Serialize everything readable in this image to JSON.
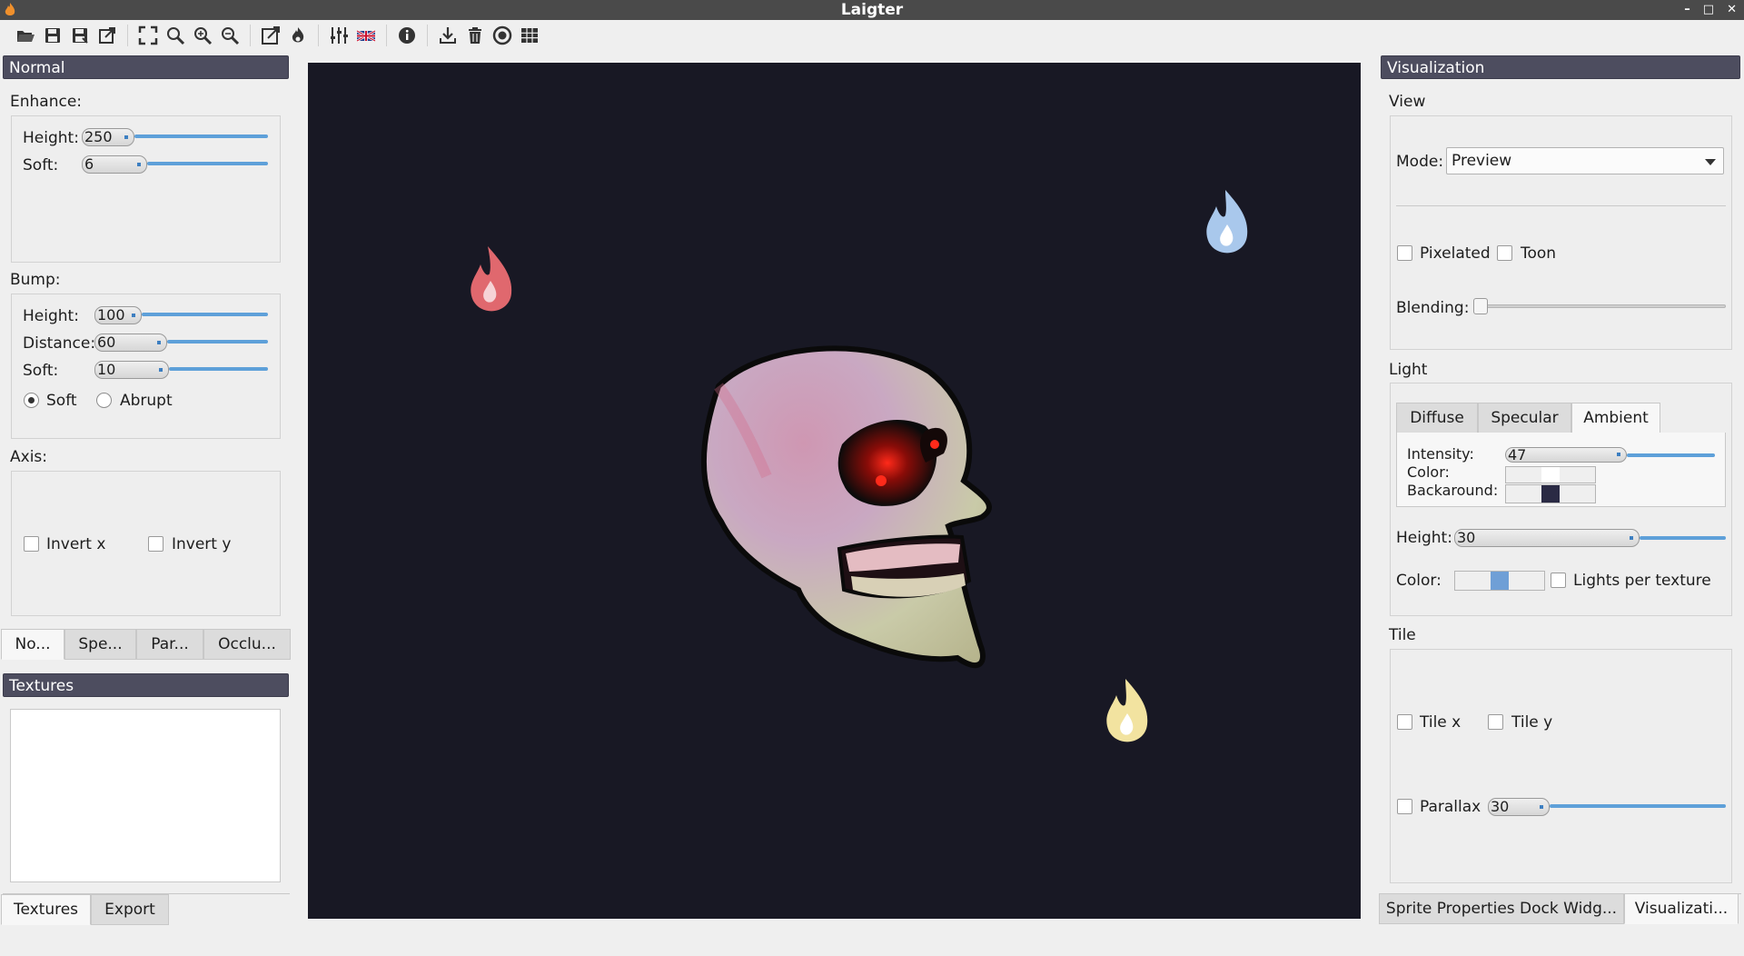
{
  "window": {
    "title": "Laigter"
  },
  "toolbar": {
    "icons": [
      "open-icon",
      "save-icon",
      "save-as-icon",
      "export-icon",
      "fit-icon",
      "zoom-icon",
      "zoom-in-icon",
      "zoom-out-icon",
      "external-icon",
      "light-icon",
      "sliders-icon",
      "language-flag-icon",
      "info-icon",
      "download-icon",
      "delete-icon",
      "target-icon",
      "grid-icon"
    ]
  },
  "left": {
    "dock_title": "Normal",
    "enhance": {
      "label": "Enhance:",
      "height_label": "Height:",
      "height_value": "250",
      "soft_label": "Soft:",
      "soft_value": "6"
    },
    "bump": {
      "label": "Bump:",
      "height_label": "Height:",
      "height_value": "100",
      "distance_label": "Distance:",
      "distance_value": "60",
      "soft_label": "Soft:",
      "soft_value": "10",
      "radio_soft": "Soft",
      "radio_abrupt": "Abrupt"
    },
    "axis": {
      "label": "Axis:",
      "invert_x": "Invert x",
      "invert_y": "Invert y"
    },
    "tabs": [
      "No...",
      "Spe...",
      "Par...",
      "Occlu..."
    ],
    "textures_title": "Textures",
    "bottom_tabs": [
      "Textures",
      "Export"
    ]
  },
  "right": {
    "dock_title": "Visualization",
    "view": {
      "label": "View",
      "mode_label": "Mode:",
      "mode_value": "Preview",
      "pixelated": "Pixelated",
      "toon": "Toon",
      "blending_label": "Blending:"
    },
    "light": {
      "label": "Light",
      "tabs": [
        "Diffuse",
        "Specular",
        "Ambient"
      ],
      "intensity_label": "Intensity:",
      "intensity_value": "47",
      "color_label": "Color:",
      "background_label": "Backaround:",
      "height_label": "Height:",
      "height_value": "30",
      "color2_label": "Color:",
      "lights_per_texture": "Lights per texture"
    },
    "tile": {
      "label": "Tile",
      "tile_x": "Tile x",
      "tile_y": "Tile y",
      "parallax": "Parallax",
      "parallax_value": "30"
    },
    "bottom_tabs": [
      "Sprite Properties Dock Widg...",
      "Visualizati..."
    ]
  },
  "colors": {
    "canvas_bg": "#181824",
    "light_red": "#e0686e",
    "light_blue": "#a9c8ec",
    "light_yellow": "#f2e3a0",
    "accent": "#5ea0d9"
  }
}
